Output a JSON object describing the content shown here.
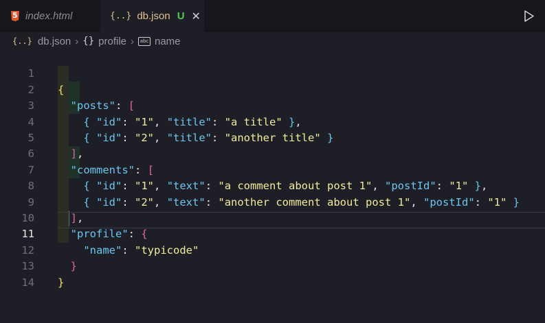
{
  "tabs": [
    {
      "label": "index.html",
      "icon": "html5-icon",
      "active": false
    },
    {
      "label": "db.json",
      "icon": "json-icon",
      "active": true,
      "status": "U"
    }
  ],
  "breadcrumb": [
    "db.json",
    "profile",
    "name"
  ],
  "editor": {
    "active_line": 11,
    "line_numbers": [
      "1",
      "2",
      "3",
      "4",
      "5",
      "6",
      "7",
      "8",
      "9",
      "10",
      "11",
      "12",
      "13",
      "14"
    ]
  },
  "colors": {
    "background": "#1e1f26",
    "key": "#6cc5f0",
    "string": "#f3eb9c",
    "brace_level1": "#f5e26b",
    "bracket_level2": "#e4649f",
    "brace_level3": "#6cc5f0",
    "modified_badge": "#4ec94e"
  }
}
